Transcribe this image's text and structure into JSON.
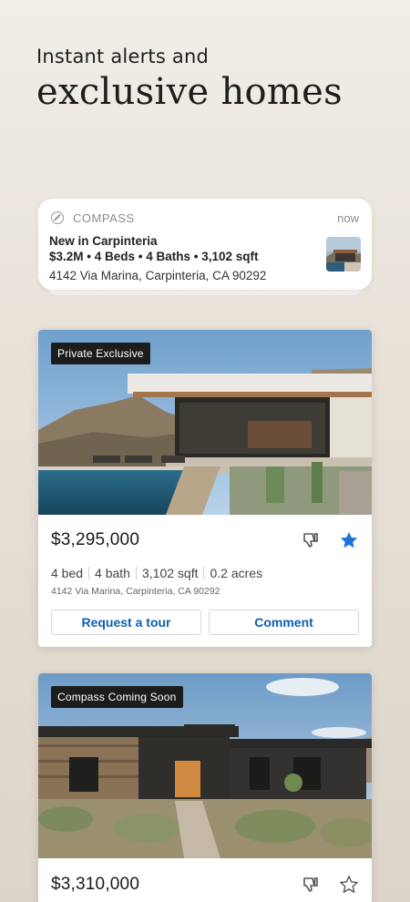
{
  "headline": {
    "line1": "Instant alerts and",
    "line2": "exclusive homes"
  },
  "notification": {
    "app_icon": "compass-icon",
    "app_name": "COMPASS",
    "time": "now",
    "title": "New in Carpinteria",
    "summary": "$3.2M • 4 Beds • 4 Baths • 3,102 sqft",
    "address": "4142 Via Marina, Carpinteria, CA 90292"
  },
  "listings": [
    {
      "badge": "Private Exclusive",
      "price": "$3,295,000",
      "beds": "4 bed",
      "baths": "4 bath",
      "sqft": "3,102 sqft",
      "lot": "0.2 acres",
      "address": "4142 Via Marina, Carpinteria, CA 90292",
      "favorited": true,
      "request_tour_label": "Request a tour",
      "comment_label": "Comment"
    },
    {
      "badge": "Compass Coming Soon",
      "price": "$3,310,000",
      "favorited": false
    }
  ],
  "colors": {
    "accent_blue": "#0e5fb0",
    "star_filled": "#1a73d9",
    "badge_bg": "#1c1c1c"
  }
}
